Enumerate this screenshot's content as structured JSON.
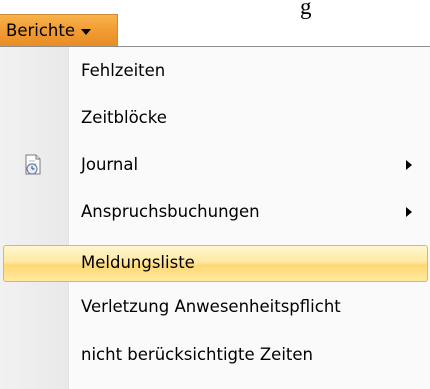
{
  "header": {
    "title_fragment": "g"
  },
  "menu_button": {
    "label": "Berichte",
    "caret_icon": "chevron-down-icon",
    "background_color": "#f09a33"
  },
  "menu": {
    "items": [
      {
        "label": "Fehlzeiten",
        "has_submenu": false,
        "icon": ""
      },
      {
        "label": "Zeitblöcke",
        "has_submenu": false,
        "icon": ""
      },
      {
        "label": "Journal",
        "has_submenu": true,
        "icon": "journal-icon"
      },
      {
        "label": "Anspruchsbuchungen",
        "has_submenu": true,
        "icon": ""
      },
      {
        "label": "Meldungsliste",
        "has_submenu": false,
        "icon": "",
        "highlighted": true
      },
      {
        "label": "Verletzung Anwesenheitspflicht",
        "has_submenu": false,
        "icon": ""
      },
      {
        "label": "nicht berücksichtigte Zeiten",
        "has_submenu": false,
        "icon": ""
      }
    ],
    "highlight_color": "#ffe9a4",
    "submenu_arrow_icon": "chevron-right-icon"
  }
}
